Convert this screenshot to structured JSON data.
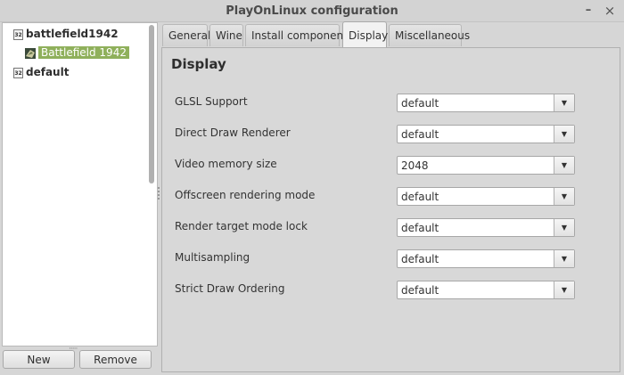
{
  "window": {
    "title": "PlayOnLinux configuration",
    "min_glyph": "–",
    "close_glyph": "×"
  },
  "tree": {
    "items": [
      {
        "badge": "32",
        "label": "battlefield1942",
        "bold": true
      },
      {
        "label": "Battlefield 1942",
        "selected": true
      },
      {
        "badge": "32",
        "label": "default",
        "bold": true
      }
    ],
    "grip": "·····"
  },
  "buttons": {
    "new": "New",
    "remove": "Remove"
  },
  "tabs": [
    "General",
    "Wine",
    "Install components",
    "Display",
    "Miscellaneous"
  ],
  "active_tab": "Display",
  "panel": {
    "title": "Display",
    "settings": [
      {
        "label": "GLSL Support",
        "value": "default"
      },
      {
        "label": "Direct Draw Renderer",
        "value": "default"
      },
      {
        "label": "Video memory size",
        "value": "2048"
      },
      {
        "label": "Offscreen rendering mode",
        "value": "default"
      },
      {
        "label": "Render target mode lock",
        "value": "default"
      },
      {
        "label": "Multisampling",
        "value": "default"
      },
      {
        "label": "Strict Draw Ordering",
        "value": "default"
      }
    ],
    "arrow_glyph": "▼"
  },
  "colors": {
    "selection": "#8fb05b",
    "background": "#d6d6d6"
  }
}
